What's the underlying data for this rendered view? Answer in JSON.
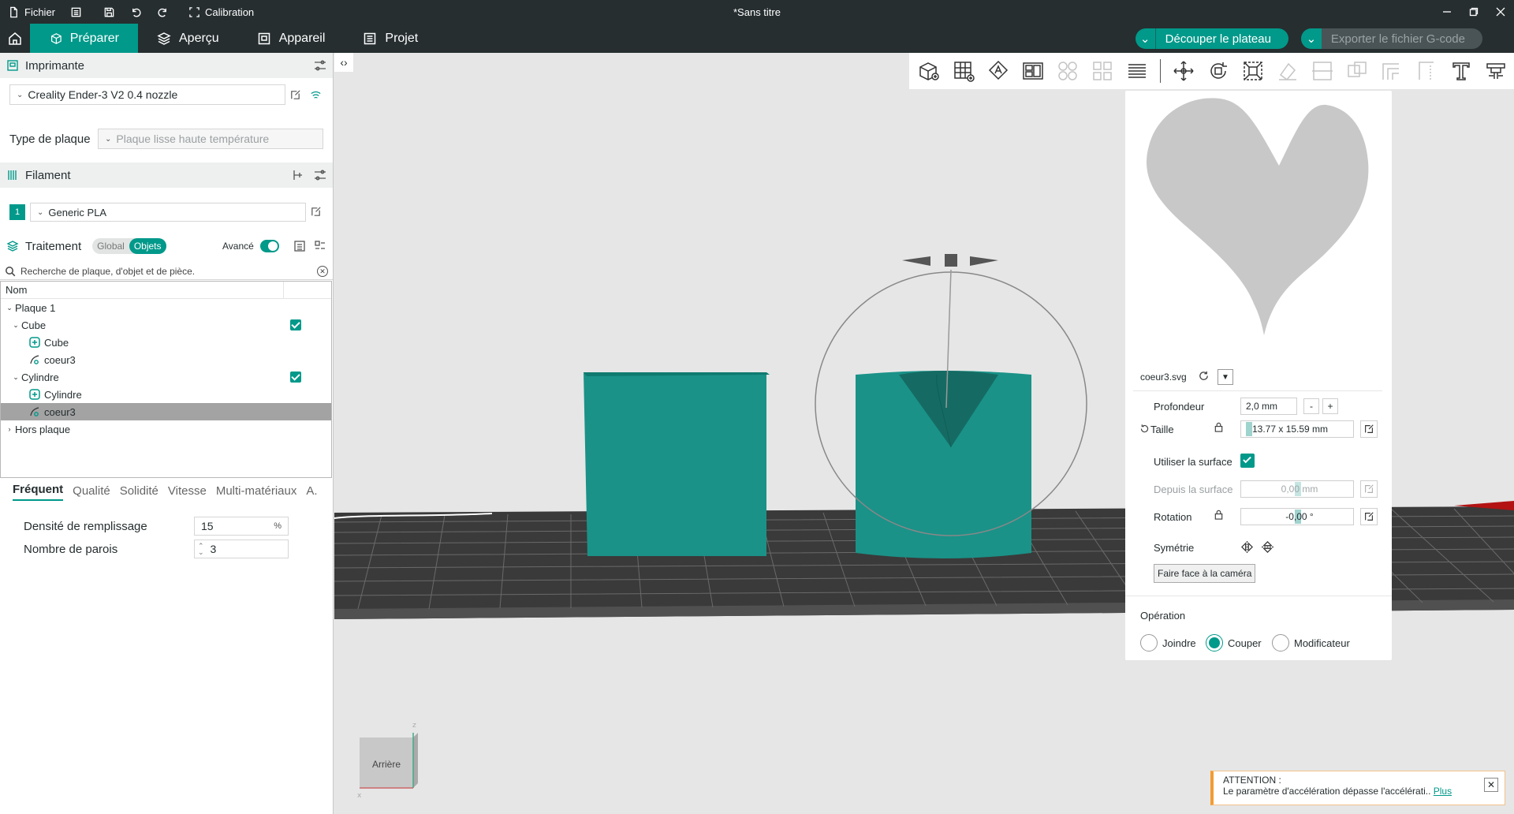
{
  "titlebar": {
    "file_label": "Fichier",
    "calibration_label": "Calibration",
    "document_title": "*Sans titre"
  },
  "menubar": {
    "tabs": [
      {
        "label": "Préparer",
        "active": true
      },
      {
        "label": "Aperçu",
        "active": false
      },
      {
        "label": "Appareil",
        "active": false
      },
      {
        "label": "Projet",
        "active": false
      }
    ],
    "slice_label": "Découper le plateau",
    "export_label": "Exporter le fichier G-code"
  },
  "printer": {
    "section_title": "Imprimante",
    "printer_name": "Creality Ender-3 V2 0.4 nozzle",
    "plate_type_label": "Type de plaque",
    "plate_type_value": "Plaque lisse haute température"
  },
  "filament": {
    "section_title": "Filament",
    "slot_number": "1",
    "filament_name": "Generic PLA"
  },
  "processing": {
    "section_title": "Traitement",
    "mode_global": "Global",
    "mode_objects": "Objets",
    "advanced_label": "Avancé",
    "search_placeholder": "Recherche de plaque, d'objet et de pièce."
  },
  "object_list": {
    "header_name": "Nom",
    "plate": "Plaque 1",
    "items": [
      {
        "label": "Cube",
        "level": 1,
        "type": "object"
      },
      {
        "label": "Cube",
        "level": 2,
        "type": "part"
      },
      {
        "label": "coeur3",
        "level": 2,
        "type": "svg"
      },
      {
        "label": "Cylindre",
        "level": 1,
        "type": "object"
      },
      {
        "label": "Cylindre",
        "level": 2,
        "type": "part"
      },
      {
        "label": "coeur3",
        "level": 2,
        "type": "svg",
        "selected": true
      }
    ],
    "off_plate": "Hors plaque"
  },
  "param_tabs": [
    "Fréquent",
    "Qualité",
    "Solidité",
    "Vitesse",
    "Multi-matériaux",
    "A."
  ],
  "params": {
    "infill_label": "Densité de remplissage",
    "infill_value": "15",
    "infill_unit": "%",
    "walls_label": "Nombre de parois",
    "walls_value": "3"
  },
  "svg_panel": {
    "filename": "coeur3.svg",
    "depth_label": "Profondeur",
    "depth_value": "2,0 mm",
    "size_label": "Taille",
    "size_value": "13.77 x 15.59 mm",
    "use_surface_label": "Utiliser la surface",
    "from_surface_label": "Depuis la surface",
    "from_surface_value": "0,00 mm",
    "rotation_label": "Rotation",
    "rotation_value": "-0,00 °",
    "symmetry_label": "Symétrie",
    "face_camera_label": "Faire face à la caméra",
    "operation_label": "Opération",
    "operations": [
      {
        "label": "Joindre",
        "selected": false
      },
      {
        "label": "Couper",
        "selected": true
      },
      {
        "label": "Modificateur",
        "selected": false
      }
    ]
  },
  "view_cube": {
    "label": "Arrière"
  },
  "notification": {
    "title": "ATTENTION :",
    "message": "Le paramètre d'accélération dépasse l'accélérati..",
    "link": "Plus"
  },
  "colors": {
    "accent": "#00998a",
    "dark": "#262e30",
    "object": "#1a9288"
  }
}
